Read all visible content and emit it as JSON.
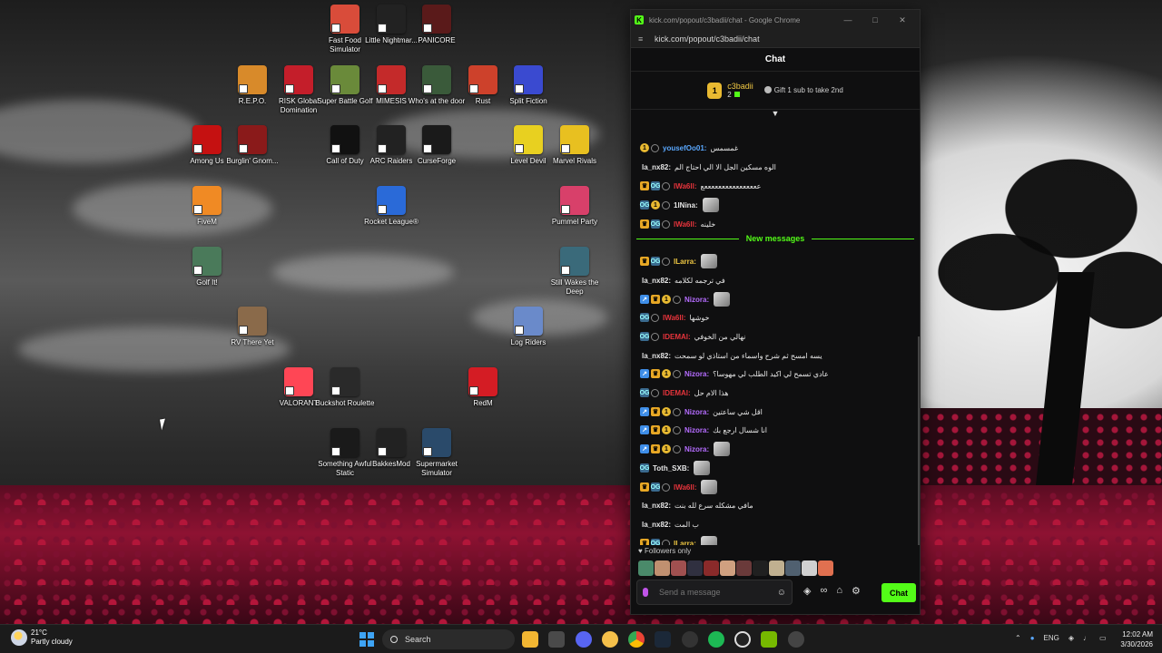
{
  "desktop": {
    "icons": [
      {
        "label": "Fast Food Simulator",
        "icon": "fast-food-icon",
        "color": "#d94c3a"
      },
      {
        "label": "Little Nightmar...",
        "icon": "little-nightmares-icon",
        "color": "#222222"
      },
      {
        "label": "PANICORE",
        "icon": "panicore-icon",
        "color": "#5a1a1a"
      },
      {
        "label": "R.E.P.O.",
        "icon": "repo-icon",
        "color": "#d88a2a"
      },
      {
        "label": "RISK Global Domination",
        "icon": "risk-icon",
        "color": "#c41e2a"
      },
      {
        "label": "Super Battle Golf",
        "icon": "golf-ball-icon",
        "color": "#6a8a3a"
      },
      {
        "label": "MIMESIS",
        "icon": "mimesis-icon",
        "color": "#c42a2a"
      },
      {
        "label": "Who's at the door",
        "icon": "door-icon",
        "color": "#3a5a3a"
      },
      {
        "label": "Rust",
        "icon": "rust-icon",
        "color": "#cd412b"
      },
      {
        "label": "Split Fiction",
        "icon": "split-fiction-icon",
        "color": "#3a4ad0"
      },
      {
        "label": "Among Us",
        "icon": "among-us-icon",
        "color": "#c51111"
      },
      {
        "label": "Burglin' Gnom...",
        "icon": "gnome-icon",
        "color": "#8a1a1a"
      },
      {
        "label": "Call of Duty",
        "icon": "call-of-duty-icon",
        "color": "#111111"
      },
      {
        "label": "ARC Raiders",
        "icon": "arc-raiders-icon",
        "color": "#222222"
      },
      {
        "label": "CurseForge",
        "icon": "curseforge-icon",
        "color": "#1a1a1a"
      },
      {
        "label": "Level Devil",
        "icon": "level-devil-icon",
        "color": "#e8d020"
      },
      {
        "label": "Marvel Rivals",
        "icon": "marvel-rivals-icon",
        "color": "#e8c020"
      },
      {
        "label": "FiveM",
        "icon": "fivem-icon",
        "color": "#f08a24"
      },
      {
        "label": "Rocket League®",
        "icon": "rocket-league-icon",
        "color": "#2a6ad8"
      },
      {
        "label": "Pummel Party",
        "icon": "pummel-party-icon",
        "color": "#d8406a"
      },
      {
        "label": "Golf It!",
        "icon": "golf-it-icon",
        "color": "#4a7a5a"
      },
      {
        "label": "Still Wakes the Deep",
        "icon": "still-wakes-icon",
        "color": "#3a6a7a"
      },
      {
        "label": "RV There Yet",
        "icon": "rv-there-yet-icon",
        "color": "#8a6a4a"
      },
      {
        "label": "Log Riders",
        "icon": "log-riders-icon",
        "color": "#6a8aca"
      },
      {
        "label": "VALORANT",
        "icon": "valorant-icon",
        "color": "#ff4655"
      },
      {
        "label": "Buckshot Roulette",
        "icon": "buckshot-roulette-icon",
        "color": "#2a2a2a"
      },
      {
        "label": "RedM",
        "icon": "redm-icon",
        "color": "#d41c24"
      },
      {
        "label": "Something Awful Static",
        "icon": "something-awful-icon",
        "color": "#1a1a1a"
      },
      {
        "label": "BakkesMod",
        "icon": "bakkesmod-icon",
        "color": "#222222"
      },
      {
        "label": "Supermarket Simulator",
        "icon": "supermarket-icon",
        "color": "#2a4a6a"
      }
    ]
  },
  "popup": {
    "window_title": "kick.com/popout/c3badii/chat - Google Chrome",
    "url": "kick.com/popout/c3badii/chat",
    "chat_title": "Chat",
    "sub_banner": {
      "rank": "1",
      "name": "c3badii",
      "count": "2",
      "gift_text": "Gift 1 sub to take 2nd"
    },
    "new_messages_label": "New messages",
    "messages": [
      {
        "user": "yousefOo01:",
        "user_color": "#5aa8ff",
        "text": "غمسمس",
        "badges": [
          "sub",
          "verified"
        ]
      },
      {
        "user": "la_nx82:",
        "user_color": "#e6e6e6",
        "text": "الوه مسكين الجل الا الي احتاج الم",
        "badges": []
      },
      {
        "user": "lWa6ll:",
        "user_color": "#e8343c",
        "text": "ععععععععععععععععع",
        "badges": [
          "crown",
          "og",
          "verified"
        ]
      },
      {
        "user": "1lNina:",
        "user_color": "#e6e6e6",
        "text": "",
        "badges": [
          "og",
          "sub",
          "verified"
        ],
        "emote": true
      },
      {
        "user": "lWa6ll:",
        "user_color": "#e8343c",
        "text": "خلينه",
        "badges": [
          "crown",
          "og",
          "verified"
        ]
      },
      {
        "user": "lLarra:",
        "user_color": "#f0c843",
        "text": "",
        "badges": [
          "crown",
          "og",
          "verified"
        ],
        "emote": true
      },
      {
        "user": "la_nx82:",
        "user_color": "#e6e6e6",
        "text": "في ترجمه لكلامه",
        "badges": []
      },
      {
        "user": "Nizora:",
        "user_color": "#b56cff",
        "text": "",
        "badges": [
          "vip",
          "crown",
          "sub",
          "verified"
        ],
        "emote": true
      },
      {
        "user": "lWa6ll:",
        "user_color": "#e8343c",
        "text": "خوشها",
        "badges": [
          "og",
          "verified"
        ]
      },
      {
        "user": "lDEMAl:",
        "user_color": "#e8343c",
        "text": "نهالي من الخوفي",
        "badges": [
          "og",
          "verified"
        ]
      },
      {
        "user": "la_nx82:",
        "user_color": "#e6e6e6",
        "text": "يسه امسح ثم شرح واسماء من استاذي لو سمحت",
        "badges": []
      },
      {
        "user": "Nizora:",
        "user_color": "#b56cff",
        "text": "عادي تسمح لي اكيد الطلب لي مهوسا؟",
        "badges": [
          "vip",
          "crown",
          "sub",
          "verified"
        ]
      },
      {
        "user": "lDEMAl:",
        "user_color": "#e8343c",
        "text": "هذا الام حل",
        "badges": [
          "og",
          "verified"
        ]
      },
      {
        "user": "Nizora:",
        "user_color": "#b56cff",
        "text": "اقل شي ساعتين",
        "badges": [
          "vip",
          "crown",
          "sub",
          "verified"
        ]
      },
      {
        "user": "Nizora:",
        "user_color": "#b56cff",
        "text": "انا شسال ارجع بك",
        "badges": [
          "vip",
          "crown",
          "sub",
          "verified"
        ]
      },
      {
        "user": "Nizora:",
        "user_color": "#b56cff",
        "text": "",
        "badges": [
          "vip",
          "crown",
          "sub",
          "verified"
        ],
        "emote": true
      },
      {
        "user": "Toth_SXB:",
        "user_color": "#e6e6e6",
        "text": "",
        "badges": [
          "og"
        ],
        "emote": true
      },
      {
        "user": "lWa6ll:",
        "user_color": "#e8343c",
        "text": "",
        "badges": [
          "crown",
          "og",
          "verified"
        ],
        "emote": true
      },
      {
        "user": "la_nx82:",
        "user_color": "#e6e6e6",
        "text": "مافي مشكله سرع لله بنت",
        "badges": []
      },
      {
        "user": "la_nx82:",
        "user_color": "#e6e6e6",
        "text": "ب المت",
        "badges": []
      },
      {
        "user": "lLarra:",
        "user_color": "#f0c843",
        "text": "",
        "badges": [
          "crown",
          "og",
          "verified"
        ],
        "emote": true
      }
    ],
    "followers_label": "Followers only",
    "composer_placeholder": "Send a message",
    "send_label": "Chat"
  },
  "taskbar": {
    "weather_temp": "21°C",
    "weather_desc": "Partly cloudy",
    "search_label": "Search",
    "language": "ENG",
    "time": "12:02 AM",
    "date": "3/30/2026"
  }
}
